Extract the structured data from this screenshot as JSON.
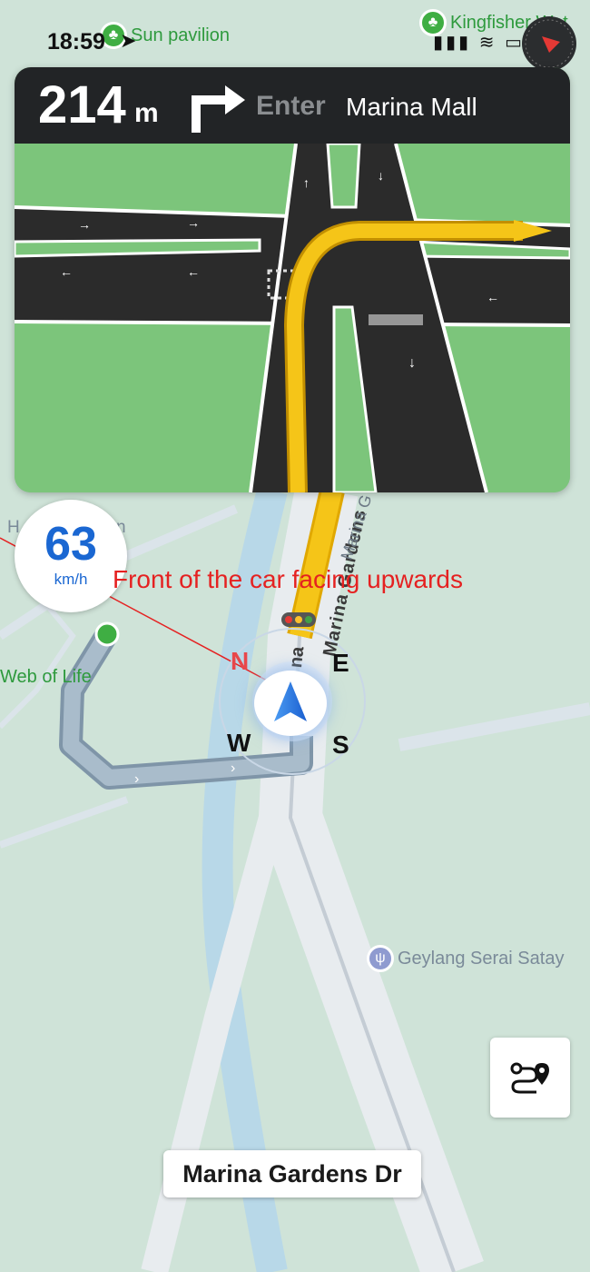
{
  "status_bar": {
    "time": "18:59",
    "location_icon": "location-arrow-icon",
    "signal_icon": "signal-icon",
    "wifi_icon": "wifi-icon",
    "battery_icon": "battery-icon"
  },
  "pois": [
    {
      "label": "Sun pavilion",
      "icon": "tree-icon"
    },
    {
      "label": "Kingfisher Wet",
      "icon": "tree-icon"
    },
    {
      "label": "Web of Life",
      "icon": "tree-icon"
    },
    {
      "label": "Geylang Serai Satay",
      "icon": "restaurant-icon"
    }
  ],
  "map_labels": {
    "road_main": "Marina Gardens",
    "road_side": "Marina G",
    "road_bottom_label": "na",
    "hint_h": "H",
    "hint_n": "n"
  },
  "navigation": {
    "distance_value": "214",
    "distance_unit": "m",
    "maneuver_icon": "turn-right-icon",
    "enter_label": "Enter",
    "destination": "Marina Mall"
  },
  "speed": {
    "value": "63",
    "unit": "km/h"
  },
  "annotation": {
    "text": "Front of the car facing upwards"
  },
  "compass": {
    "north": "N",
    "east": "E",
    "south": "S",
    "west": "W"
  },
  "route_button": {
    "icon": "route-icon"
  },
  "current_street": "Marina Gardens Dr",
  "colors": {
    "map_bg": "#cfe3d8",
    "card_header": "#222426",
    "grass": "#7cc57b",
    "route_yellow": "#f5c518",
    "speed_blue": "#1a67d2",
    "annotation_red": "#e52121",
    "poi_green": "#3fae43"
  }
}
